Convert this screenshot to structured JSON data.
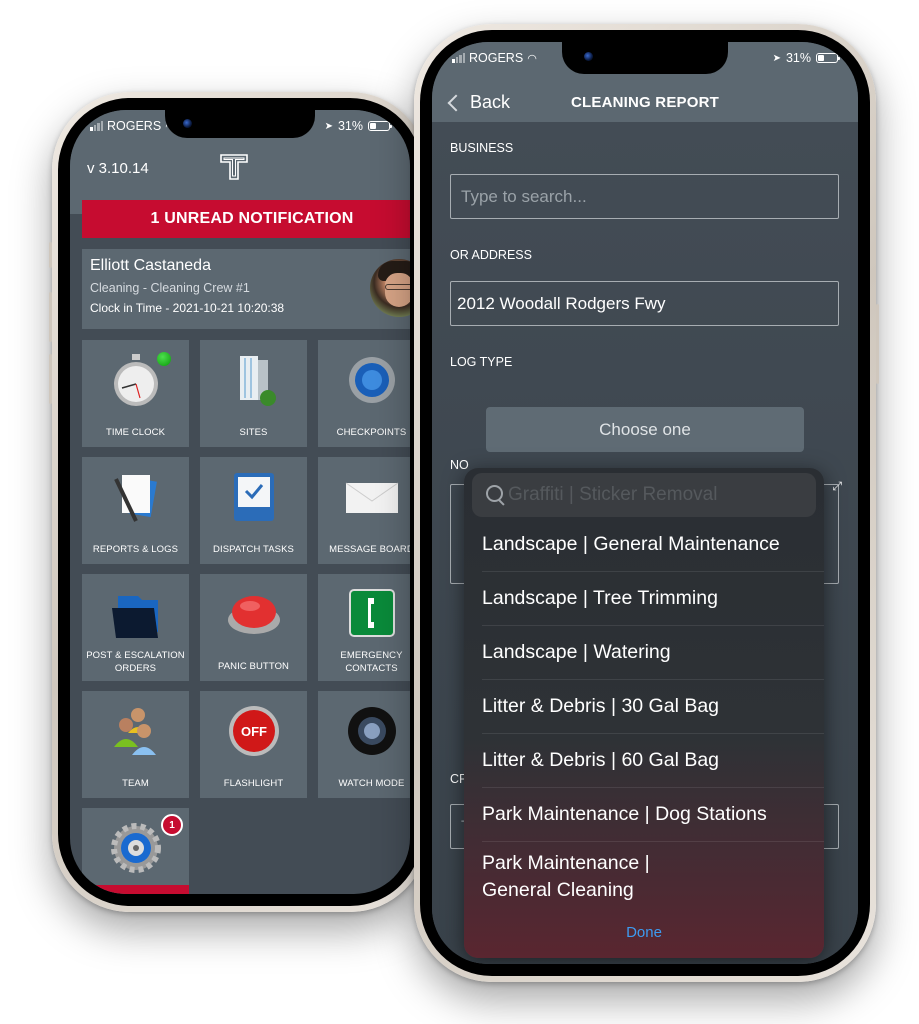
{
  "phone_left": {
    "status": {
      "carrier": "ROGERS",
      "battery": "31%"
    },
    "version": "v 3.10.14",
    "logo": "T",
    "notification_banner": "1 UNREAD NOTIFICATION",
    "user": {
      "name": "Elliott Castaneda",
      "role": "Cleaning - Cleaning Crew #1",
      "clock_in": "Clock in Time - 2021-10-21 10:20:38"
    },
    "tiles": [
      {
        "label": "TIME CLOCK",
        "icon": "stopwatch-icon"
      },
      {
        "label": "SITES",
        "icon": "building-icon"
      },
      {
        "label": "CHECKPOINTS",
        "icon": "radar-icon"
      },
      {
        "label": "REPORTS & LOGS",
        "icon": "document-pen-icon"
      },
      {
        "label": "DISPATCH TASKS",
        "icon": "inbox-check-icon"
      },
      {
        "label": "MESSAGE BOARD",
        "icon": "envelope-icon"
      },
      {
        "label": "POST & ESCALATION ORDERS",
        "icon": "folder-icon"
      },
      {
        "label": "PANIC BUTTON",
        "icon": "red-button-icon"
      },
      {
        "label": "EMERGENCY CONTACTS",
        "icon": "phone-icon"
      },
      {
        "label": "TEAM",
        "icon": "team-icon"
      },
      {
        "label": "FLASHLIGHT",
        "icon": "flashlight-off-icon"
      },
      {
        "label": "WATCH MODE",
        "icon": "camera-lens-icon"
      },
      {
        "label": "SETTINGS",
        "icon": "gear-icon",
        "badge": "1"
      }
    ],
    "colors": {
      "accent": "#c60c30",
      "tile": "#5c6871",
      "background": "#434c55"
    }
  },
  "phone_right": {
    "status": {
      "carrier": "ROGERS",
      "battery": "31%"
    },
    "nav": {
      "back_label": "Back",
      "title": "CLEANING REPORT"
    },
    "form": {
      "business_label": "BUSINESS",
      "business_placeholder": "Type to search...",
      "address_label": "OR ADDRESS",
      "address_value": "2012 Woodall Rodgers Fwy",
      "log_type_label": "LOG TYPE",
      "log_type_value": "Choose one",
      "notes_label_partial": "NO",
      "crew_label_partial": "CR",
      "crew_input_partial": "T"
    },
    "picker": {
      "search_text": "Graffiti | Sticker Removal",
      "options": [
        "Landscape | General Maintenance",
        "Landscape | Tree Trimming",
        "Landscape | Watering",
        "Litter & Debris | 30 Gal Bag",
        "Litter & Debris | 60 Gal Bag",
        "Park Maintenance | Dog Stations",
        "Park Maintenance | General Cleaning"
      ],
      "done_label": "Done"
    },
    "colors": {
      "link": "#3d9bf0"
    }
  }
}
